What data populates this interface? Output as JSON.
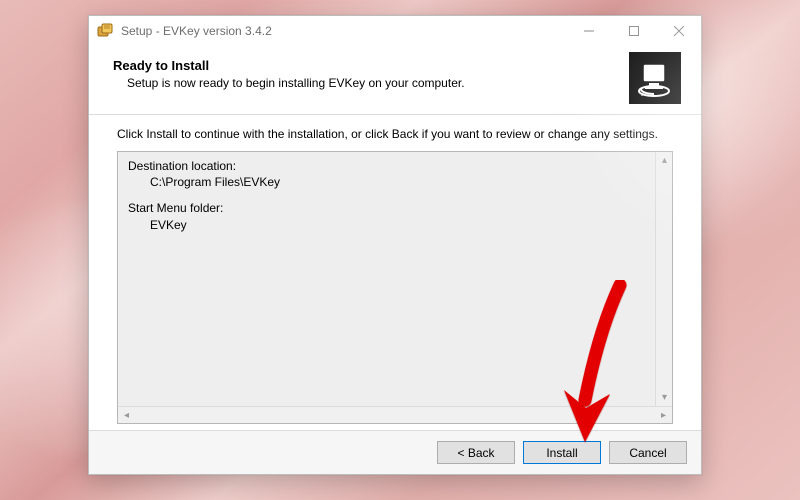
{
  "titlebar": {
    "text": "Setup - EVKey version 3.4.2"
  },
  "header": {
    "heading": "Ready to Install",
    "subtext": "Setup is now ready to begin installing EVKey on your computer."
  },
  "instruction": "Click Install to continue with the installation, or click Back if you want to review or change any settings.",
  "summary": {
    "dest_label": "Destination location:",
    "dest_value": "C:\\Program Files\\EVKey",
    "startmenu_label": "Start Menu folder:",
    "startmenu_value": "EVKey"
  },
  "buttons": {
    "back": "< Back",
    "install": "Install",
    "cancel": "Cancel"
  },
  "glyphs": {
    "up": "▴",
    "down": "▾",
    "left": "◂",
    "right": "▸"
  }
}
